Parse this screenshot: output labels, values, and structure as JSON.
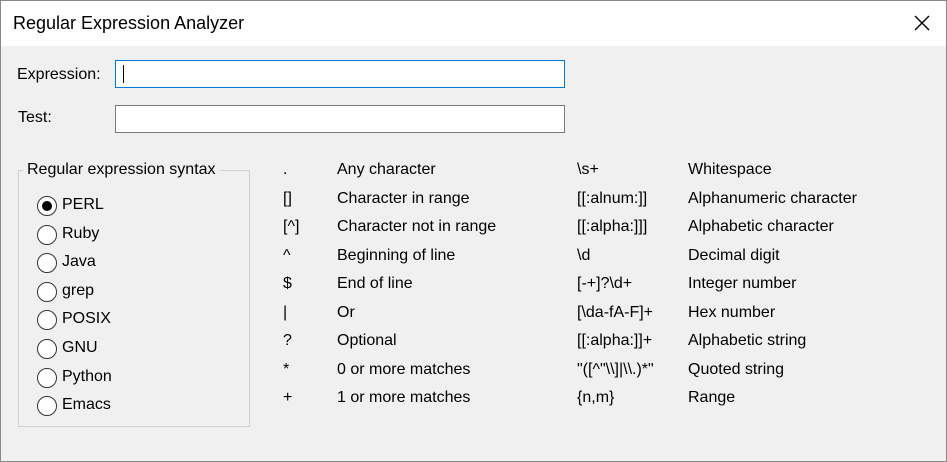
{
  "window": {
    "title": "Regular Expression Analyzer"
  },
  "form": {
    "expression_label": "Expression:",
    "expression_value": "",
    "test_label": "Test:",
    "test_value": ""
  },
  "syntax": {
    "group_title": "Regular expression syntax",
    "selected": "PERL",
    "options": [
      "PERL",
      "Ruby",
      "Java",
      "grep",
      "POSIX",
      "GNU",
      "Python",
      "Emacs"
    ]
  },
  "reference": {
    "left": [
      {
        "symbol": ".",
        "meaning": "Any character"
      },
      {
        "symbol": "[]",
        "meaning": "Character in range"
      },
      {
        "symbol": "[^]",
        "meaning": "Character not in range"
      },
      {
        "symbol": "^",
        "meaning": "Beginning of line"
      },
      {
        "symbol": "$",
        "meaning": "End of line"
      },
      {
        "symbol": "|",
        "meaning": "Or"
      },
      {
        "symbol": "?",
        "meaning": "Optional"
      },
      {
        "symbol": "*",
        "meaning": "0 or more matches"
      },
      {
        "symbol": "+",
        "meaning": "1 or more matches"
      }
    ],
    "right": [
      {
        "symbol": "\\s+",
        "meaning": "Whitespace"
      },
      {
        "symbol": "[[:alnum:]]",
        "meaning": "Alphanumeric character"
      },
      {
        "symbol": "[[:alpha:]]]",
        "meaning": "Alphabetic character"
      },
      {
        "symbol": "\\d",
        "meaning": "Decimal digit"
      },
      {
        "symbol": "[-+]?\\d+",
        "meaning": "Integer number"
      },
      {
        "symbol": "[\\da-fA-F]+",
        "meaning": "Hex number"
      },
      {
        "symbol": "[[:alpha:]]+",
        "meaning": "Alphabetic string"
      },
      {
        "symbol": "\"([^\"\\\\]|\\\\.)*\"",
        "meaning": "Quoted string"
      },
      {
        "symbol": "{n,m}",
        "meaning": "Range"
      }
    ]
  }
}
